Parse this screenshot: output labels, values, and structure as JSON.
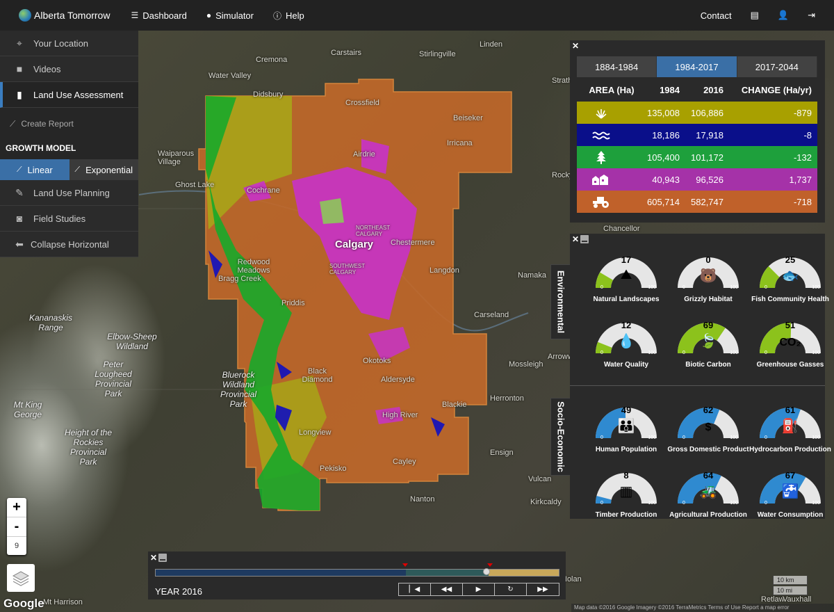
{
  "nav": {
    "brand": "Alberta Tomorrow",
    "items": [
      {
        "label": "Dashboard",
        "icon": "th-list-icon"
      },
      {
        "label": "Simulator",
        "icon": "globe-icon"
      },
      {
        "label": "Help",
        "icon": "question-icon"
      }
    ],
    "contact": "Contact"
  },
  "sidebar": {
    "items": [
      {
        "label": "Your Location",
        "icon": "crosshair-icon"
      },
      {
        "label": "Videos",
        "icon": "video-icon"
      },
      {
        "label": "Land Use Assessment",
        "icon": "bar-chart-icon"
      }
    ],
    "create_report": "Create Report",
    "growth_model_title": "GROWTH MODEL",
    "growth_linear": "Linear",
    "growth_exponential": "Exponential",
    "items2": [
      {
        "label": "Land Use Planning",
        "icon": "pencil-icon"
      },
      {
        "label": "Field Studies",
        "icon": "camera-icon"
      },
      {
        "label": "Collapse Horizontal",
        "icon": "arrow-left-icon"
      }
    ]
  },
  "area_table": {
    "tabs": [
      "1884-1984",
      "1984-2017",
      "2017-2044"
    ],
    "active_tab": "1984-2017",
    "headers": [
      "AREA (Ha)",
      "1984",
      "2016",
      "CHANGE (Ha/yr)"
    ],
    "rows": [
      {
        "type": "grassland-icon",
        "y1984": "135,008",
        "y2016": "106,886",
        "change": "-879",
        "color": "#a8a000"
      },
      {
        "type": "water-icon",
        "y1984": "18,186",
        "y2016": "17,918",
        "change": "-8",
        "color": "#0a0f8a"
      },
      {
        "type": "tree-icon",
        "y1984": "105,400",
        "y2016": "101,172",
        "change": "-132",
        "color": "#1ea03c"
      },
      {
        "type": "settlement-icon",
        "y1984": "40,943",
        "y2016": "96,526",
        "change": "1,737",
        "color": "#a532a8"
      },
      {
        "type": "tractor-icon",
        "y1984": "605,714",
        "y2016": "582,747",
        "change": "-718",
        "color": "#c0612a"
      }
    ]
  },
  "indicators": {
    "environmental_label": "Environmental",
    "socio_label": "Socio-Economic",
    "min": "0",
    "max": "100",
    "environmental": [
      {
        "label": "Natural Landscapes",
        "value": 17,
        "icon": "landscape-icon",
        "color": "#8cc21c"
      },
      {
        "label": "Grizzly Habitat",
        "value": 0,
        "icon": "bear-icon",
        "color": "#8cc21c"
      },
      {
        "label": "Fish Community Health",
        "value": 25,
        "icon": "fish-icon",
        "color": "#8cc21c"
      },
      {
        "label": "Water Quality",
        "value": 12,
        "icon": "drop-icon",
        "color": "#8cc21c"
      },
      {
        "label": "Biotic Carbon",
        "value": 69,
        "icon": "leaf-icon",
        "color": "#8cc21c"
      },
      {
        "label": "Greenhouse Gasses",
        "value": 51,
        "icon": "co2-icon",
        "color": "#8cc21c"
      }
    ],
    "socio": [
      {
        "label": "Human Population",
        "value": 49,
        "icon": "people-icon",
        "color": "#2f8ad0"
      },
      {
        "label": "Gross Domestic Product",
        "value": 62,
        "icon": "dollar-icon",
        "color": "#2f8ad0"
      },
      {
        "label": "Hydrocarbon Production",
        "value": 61,
        "icon": "pumpjack-icon",
        "color": "#2f8ad0"
      },
      {
        "label": "Timber Production",
        "value": 8,
        "icon": "logs-icon",
        "color": "#2f8ad0"
      },
      {
        "label": "Agricultural Production",
        "value": 64,
        "icon": "tractor-icon",
        "color": "#2f8ad0"
      },
      {
        "label": "Water Consumption",
        "value": 67,
        "icon": "faucet-icon",
        "color": "#2f8ad0"
      }
    ]
  },
  "timeline": {
    "year_label": "YEAR 2016",
    "progress": 0.82
  },
  "map": {
    "zoom_level": "9",
    "scale_km": "10 km",
    "scale_mi": "10 mi",
    "attribution": "Map data ©2016 Google Imagery ©2016 TerraMetrics   Terms of Use   Report a map error",
    "google": "Google",
    "labels": [
      "Cremona",
      "Carstairs",
      "Linden",
      "Water Valley",
      "Didsbury",
      "Stirlingville",
      "Crossfield",
      "Beiseker",
      "Irricana",
      "Airdrie",
      "Waiparous Village",
      "Ghost Lake",
      "Cochrane",
      "Calgary",
      "NORTHEAST CALGARY",
      "Chestermere",
      "SOUTHWEST CALGARY",
      "Langdon",
      "Redwood Meadows",
      "Bragg Creek",
      "Priddis",
      "Kananaskis Range",
      "Elbow-Sheep Wildland",
      "Peter Lougheed Provincial Park",
      "Bluerock Wildland Provincial Park",
      "Black Diamond",
      "Okotoks",
      "Aldersyde",
      "High River",
      "Blackie",
      "Longview",
      "Cayley",
      "Pekisko",
      "Mt King George",
      "Height of the Rockies Provincial Park",
      "Mt Harrison",
      "Carseland",
      "Namaka",
      "Mossleigh",
      "Herronton",
      "Ensign",
      "Vulcan",
      "Nanton",
      "Kirkcaldy",
      "Arrowwood",
      "Chancellor",
      "Rocky",
      "Strathmore",
      "Nolan",
      "Retlaw",
      "Vauxhall"
    ]
  }
}
